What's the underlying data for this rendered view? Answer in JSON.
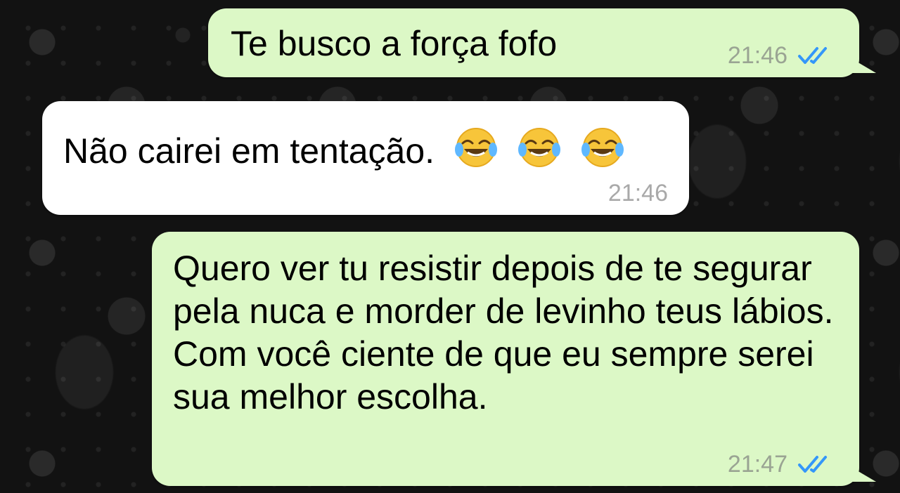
{
  "chat": {
    "messages": [
      {
        "direction": "outgoing",
        "text": "Te busco a força fofo",
        "time": "21:46",
        "status_icon": "double-check-icon"
      },
      {
        "direction": "incoming",
        "text": "Não cairei em tentação.",
        "emojis": [
          "face-with-tears-of-joy-icon",
          "face-with-tears-of-joy-icon",
          "face-with-tears-of-joy-icon"
        ],
        "time": "21:46"
      },
      {
        "direction": "outgoing",
        "text": "Quero ver tu resistir depois de te segurar pela nuca e morder de levinho teus lábios. Com você ciente de que eu sempre serei sua melhor escolha.",
        "time": "21:47",
        "status_icon": "double-check-icon"
      }
    ]
  },
  "colors": {
    "outgoing_bubble": "#dcf8c6",
    "incoming_bubble": "#ffffff",
    "read_ticks": "#3497f9",
    "timestamp_outgoing": "#9aa493",
    "timestamp_incoming": "#a9a9a9",
    "wallpaper": "#121212"
  }
}
